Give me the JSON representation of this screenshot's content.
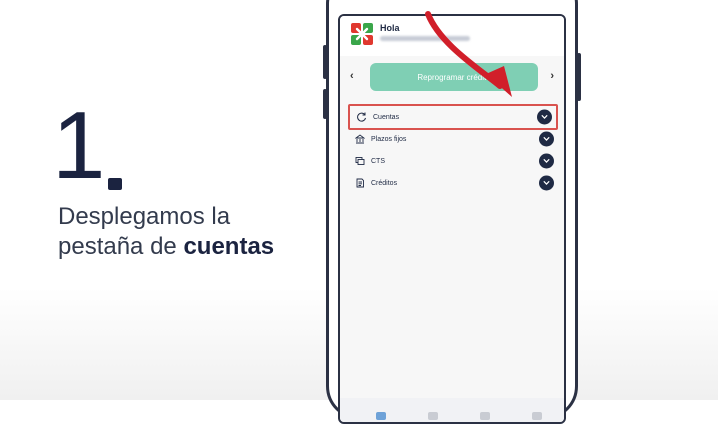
{
  "instruction": {
    "step_number": "1",
    "line1": "Desplegamos la",
    "line2_prefix": "pestaña de ",
    "line2_bold": "cuentas"
  },
  "app": {
    "greeting": "Hola",
    "promo_button_label": "Reprogramar crédito",
    "accordion": [
      {
        "label": "Cuentas",
        "icon": "refresh-icon"
      },
      {
        "label": "Plazos fijos",
        "icon": "bank-icon"
      },
      {
        "label": "CTS",
        "icon": "cards-icon"
      },
      {
        "label": "Créditos",
        "icon": "document-icon"
      }
    ]
  },
  "colors": {
    "navy": "#1f2a44",
    "accent_green": "#7fcfb4",
    "highlight_red": "#d9534f",
    "arrow_red": "#d11f2a"
  }
}
